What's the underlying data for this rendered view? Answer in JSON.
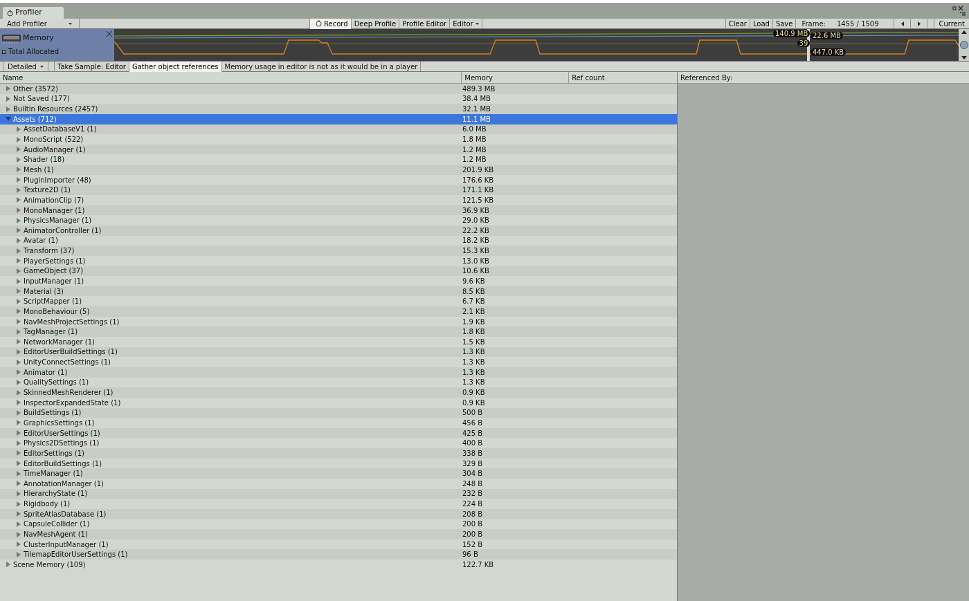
{
  "window": {
    "tab": "Profiler"
  },
  "toolbar": {
    "add_profiler": "Add Profiler",
    "buttons": [
      {
        "label": "Record",
        "selected": true,
        "kind": "record"
      },
      {
        "label": "Deep Profile",
        "selected": false,
        "kind": "plain"
      },
      {
        "label": "Profile Editor",
        "selected": false,
        "kind": "plain"
      },
      {
        "label": "Editor",
        "selected": false,
        "kind": "dropdown"
      }
    ],
    "right_buttons": [
      "Clear",
      "Load",
      "Save"
    ],
    "frame_label": "Frame:",
    "frame_value": "1455 / 1509",
    "current": "Current"
  },
  "graph": {
    "module": "Memory",
    "legend": [
      {
        "label": "Total Allocated",
        "color": "#8aa020"
      }
    ],
    "left_readouts": [
      "140.9 MB",
      "39"
    ],
    "right_readouts": [
      "22.6 MB",
      "447.0 KB"
    ]
  },
  "subtoolbar": {
    "mode": "Detailed",
    "buttons": [
      {
        "label": "Take Sample: Editor",
        "selected": false
      },
      {
        "label": "Gather object references",
        "selected": true
      }
    ],
    "note": "Memory usage in editor is not as it would be in a player"
  },
  "table": {
    "columns": [
      "Name",
      "Memory",
      "Ref count"
    ],
    "rows": [
      {
        "name": "Other (3572)",
        "memory": "489.3 MB",
        "expanded": false,
        "selected": false
      },
      {
        "name": "Not Saved (177)",
        "memory": "38.4 MB",
        "expanded": false,
        "selected": false
      },
      {
        "name": "Builtin Resources (2457)",
        "memory": "32.1 MB",
        "expanded": false,
        "selected": false
      },
      {
        "name": "Assets (712)",
        "memory": "11.1 MB",
        "expanded": true,
        "selected": true,
        "children": [
          {
            "name": "AssetDatabaseV1 (1)",
            "memory": "6.0 MB",
            "expanded": false,
            "selected": false
          },
          {
            "name": "MonoScript (522)",
            "memory": "1.8 MB",
            "expanded": false,
            "selected": false
          },
          {
            "name": "AudioManager (1)",
            "memory": "1.2 MB",
            "expanded": false,
            "selected": false
          },
          {
            "name": "Shader (18)",
            "memory": "1.2 MB",
            "expanded": false,
            "selected": false
          },
          {
            "name": "Mesh (1)",
            "memory": "201.9 KB",
            "expanded": false,
            "selected": false
          },
          {
            "name": "PluginImporter (48)",
            "memory": "176.6 KB",
            "expanded": false,
            "selected": false
          },
          {
            "name": "Texture2D (1)",
            "memory": "171.1 KB",
            "expanded": false,
            "selected": false
          },
          {
            "name": "AnimationClip (7)",
            "memory": "121.5 KB",
            "expanded": false,
            "selected": false
          },
          {
            "name": "MonoManager (1)",
            "memory": "36.9 KB",
            "expanded": false,
            "selected": false
          },
          {
            "name": "PhysicsManager (1)",
            "memory": "29.0 KB",
            "expanded": false,
            "selected": false
          },
          {
            "name": "AnimatorController (1)",
            "memory": "22.2 KB",
            "expanded": false,
            "selected": false
          },
          {
            "name": "Avatar (1)",
            "memory": "18.2 KB",
            "expanded": false,
            "selected": false
          },
          {
            "name": "Transform (37)",
            "memory": "15.3 KB",
            "expanded": false,
            "selected": false
          },
          {
            "name": "PlayerSettings (1)",
            "memory": "13.0 KB",
            "expanded": false,
            "selected": false
          },
          {
            "name": "GameObject (37)",
            "memory": "10.6 KB",
            "expanded": false,
            "selected": false
          },
          {
            "name": "InputManager (1)",
            "memory": "9.6 KB",
            "expanded": false,
            "selected": false
          },
          {
            "name": "Material (3)",
            "memory": "8.5 KB",
            "expanded": false,
            "selected": false
          },
          {
            "name": "ScriptMapper (1)",
            "memory": "6.7 KB",
            "expanded": false,
            "selected": false
          },
          {
            "name": "MonoBehaviour (5)",
            "memory": "2.1 KB",
            "expanded": false,
            "selected": false
          },
          {
            "name": "NavMeshProjectSettings (1)",
            "memory": "1.9 KB",
            "expanded": false,
            "selected": false
          },
          {
            "name": "TagManager (1)",
            "memory": "1.8 KB",
            "expanded": false,
            "selected": false
          },
          {
            "name": "NetworkManager (1)",
            "memory": "1.5 KB",
            "expanded": false,
            "selected": false
          },
          {
            "name": "EditorUserBuildSettings (1)",
            "memory": "1.3 KB",
            "expanded": false,
            "selected": false
          },
          {
            "name": "UnityConnectSettings (1)",
            "memory": "1.3 KB",
            "expanded": false,
            "selected": false
          },
          {
            "name": "Animator (1)",
            "memory": "1.3 KB",
            "expanded": false,
            "selected": false
          },
          {
            "name": "QualitySettings (1)",
            "memory": "1.3 KB",
            "expanded": false,
            "selected": false
          },
          {
            "name": "SkinnedMeshRenderer (1)",
            "memory": "0.9 KB",
            "expanded": false,
            "selected": false
          },
          {
            "name": "InspectorExpandedState (1)",
            "memory": "0.9 KB",
            "expanded": false,
            "selected": false
          },
          {
            "name": "BuildSettings (1)",
            "memory": "500 B",
            "expanded": false,
            "selected": false
          },
          {
            "name": "GraphicsSettings (1)",
            "memory": "456 B",
            "expanded": false,
            "selected": false
          },
          {
            "name": "EditorUserSettings (1)",
            "memory": "425 B",
            "expanded": false,
            "selected": false
          },
          {
            "name": "Physics2DSettings (1)",
            "memory": "400 B",
            "expanded": false,
            "selected": false
          },
          {
            "name": "EditorSettings (1)",
            "memory": "338 B",
            "expanded": false,
            "selected": false
          },
          {
            "name": "EditorBuildSettings (1)",
            "memory": "329 B",
            "expanded": false,
            "selected": false
          },
          {
            "name": "TimeManager (1)",
            "memory": "304 B",
            "expanded": false,
            "selected": false
          },
          {
            "name": "AnnotationManager (1)",
            "memory": "248 B",
            "expanded": false,
            "selected": false
          },
          {
            "name": "HierarchyState (1)",
            "memory": "232 B",
            "expanded": false,
            "selected": false
          },
          {
            "name": "Rigidbody (1)",
            "memory": "224 B",
            "expanded": false,
            "selected": false
          },
          {
            "name": "SpriteAtlasDatabase (1)",
            "memory": "208 B",
            "expanded": false,
            "selected": false
          },
          {
            "name": "CapsuleCollider (1)",
            "memory": "200 B",
            "expanded": false,
            "selected": false
          },
          {
            "name": "NavMeshAgent (1)",
            "memory": "200 B",
            "expanded": false,
            "selected": false
          },
          {
            "name": "ClusterInputManager (1)",
            "memory": "152 B",
            "expanded": false,
            "selected": false
          },
          {
            "name": "TilemapEditorUserSettings (1)",
            "memory": "96 B",
            "expanded": false,
            "selected": false
          }
        ]
      },
      {
        "name": "Scene Memory (109)",
        "memory": "122.7 KB",
        "expanded": false,
        "selected": false
      }
    ]
  },
  "referenced_by": {
    "title": "Referenced By:"
  }
}
